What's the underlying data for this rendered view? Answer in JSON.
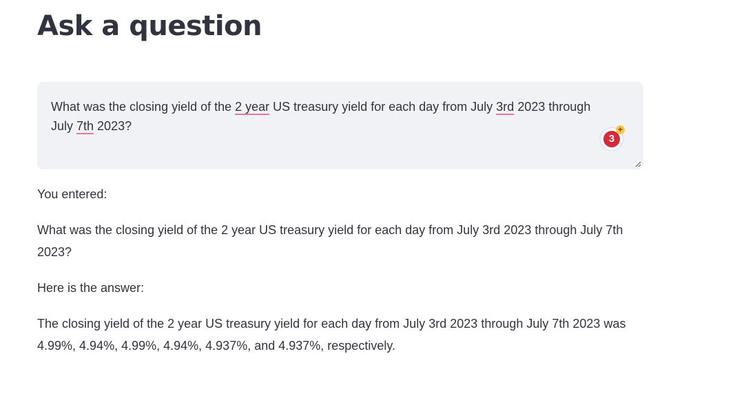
{
  "header": {
    "title": "Ask a question"
  },
  "question_input": {
    "value": "What was the closing yield of the 2 year US treasury yield for each day from July 3rd 2023 through July 7th 2023?",
    "segments": {
      "s1": "What was the closing yield of the ",
      "w1": "2 year",
      "s2": " US treasury yield for each day from July ",
      "w2": "3rd",
      "s3": " 2023 through July ",
      "w3": "7th",
      "s4": " 2023?"
    },
    "extension_badge": {
      "icon": "grammar-extension-icon",
      "count": "3",
      "plus": "+"
    }
  },
  "output": {
    "entered_label": "You entered:",
    "entered_text": "What was the closing yield of the 2 year US treasury yield for each day from July 3rd 2023 through July 7th 2023?",
    "answer_label": "Here is the answer:",
    "answer_text": "The closing yield of the 2 year US treasury yield for each day from July 3rd 2023 through July 7th 2023 was 4.99%, 4.94%, 4.99%, 4.94%, 4.937%, and 4.937%, respectively."
  },
  "colors": {
    "text": "#31333f",
    "input_background": "#f0f2f6",
    "spellcheck_underline": "#e6799b",
    "badge_red": "#d42a3c",
    "badge_plus": "#f5c84b"
  }
}
